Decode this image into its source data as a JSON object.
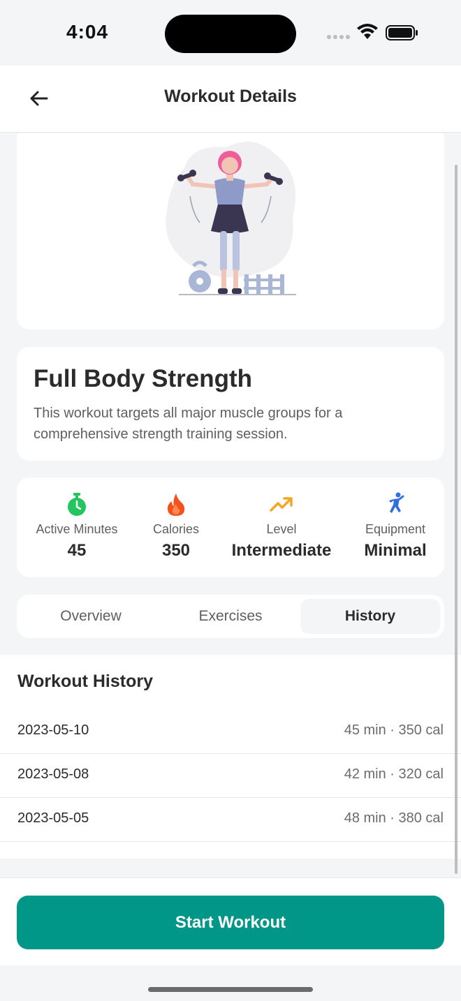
{
  "status_bar": {
    "time": "4:04"
  },
  "header": {
    "title": "Workout Details"
  },
  "workout": {
    "name": "Full Body Strength",
    "description": "This workout targets all major muscle groups for a comprehensive strength training session."
  },
  "stats": [
    {
      "label": "Active Minutes",
      "value": "45",
      "icon": "stopwatch-icon",
      "color": "#22c55e"
    },
    {
      "label": "Calories",
      "value": "350",
      "icon": "flame-icon",
      "color": "#f4511e"
    },
    {
      "label": "Level",
      "value": "Intermediate",
      "icon": "trending-up-icon",
      "color": "#f5a623"
    },
    {
      "label": "Equipment",
      "value": "Minimal",
      "icon": "athlete-icon",
      "color": "#2f6fe0"
    }
  ],
  "tabs": [
    {
      "label": "Overview",
      "active": false
    },
    {
      "label": "Exercises",
      "active": false
    },
    {
      "label": "History",
      "active": true
    }
  ],
  "history": {
    "title": "Workout History",
    "rows": [
      {
        "date": "2023-05-10",
        "meta": "45 min · 350 cal"
      },
      {
        "date": "2023-05-08",
        "meta": "42 min · 320 cal"
      },
      {
        "date": "2023-05-05",
        "meta": "48 min · 380 cal"
      }
    ]
  },
  "footer": {
    "start_label": "Start Workout"
  },
  "colors": {
    "accent": "#009688"
  }
}
